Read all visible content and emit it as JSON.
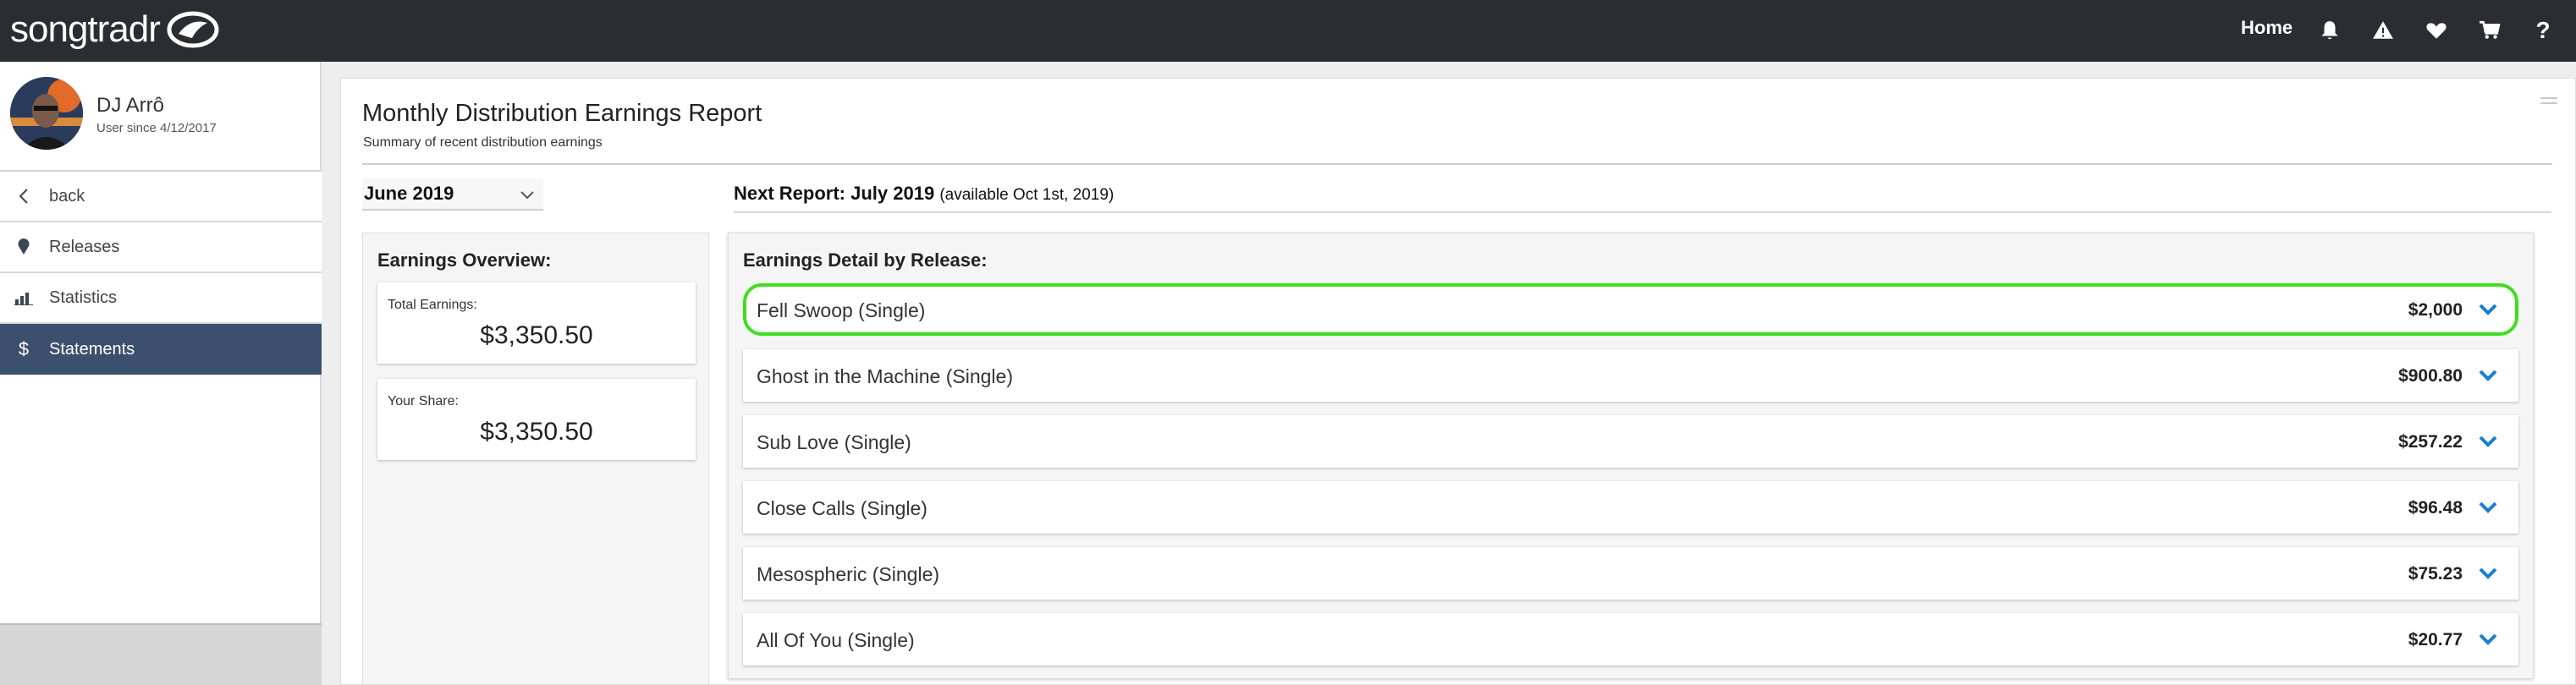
{
  "brand": {
    "logo_text": "songtradr"
  },
  "nav": {
    "home_label": "Home",
    "icons": [
      "bell-icon",
      "warning-icon",
      "heart-icon",
      "cart-icon",
      "help-icon"
    ],
    "help_glyph": "?"
  },
  "user": {
    "name": "DJ Arrô",
    "since": "User since 4/12/2017"
  },
  "sidebar": {
    "items": [
      {
        "label": "back",
        "icon": "chevron-left-icon"
      },
      {
        "label": "Releases",
        "icon": "pin-icon"
      },
      {
        "label": "Statistics",
        "icon": "bar-chart-icon"
      },
      {
        "label": "Statements",
        "icon": "dollar-icon",
        "active": true
      }
    ]
  },
  "report": {
    "title": "Monthly Distribution Earnings Report",
    "subtitle": "Summary of recent distribution earnings",
    "selected_month": "June 2019",
    "next_report_label": "Next Report: July 2019",
    "next_report_note": "(available Oct 1st, 2019)"
  },
  "overview": {
    "title": "Earnings Overview:",
    "total_label": "Total Earnings:",
    "total_value": "$3,350.50",
    "share_label": "Your Share:",
    "share_value": "$3,350.50"
  },
  "detail": {
    "title": "Earnings Detail by Release:",
    "releases": [
      {
        "name": "Fell Swoop (Single)",
        "amount": "$2,000"
      },
      {
        "name": "Ghost in the Machine (Single)",
        "amount": "$900.80"
      },
      {
        "name": "Sub Love (Single)",
        "amount": "$257.22"
      },
      {
        "name": "Close Calls (Single)",
        "amount": "$96.48"
      },
      {
        "name": "Mesospheric (Single)",
        "amount": "$75.23"
      },
      {
        "name": "All Of You (Single)",
        "amount": "$20.77"
      }
    ]
  },
  "colors": {
    "topbar": "#2b2d30",
    "sidebar_active": "#3d4f6e",
    "chevron_accent": "#1a7fd0",
    "highlight": "#3ede1e"
  }
}
